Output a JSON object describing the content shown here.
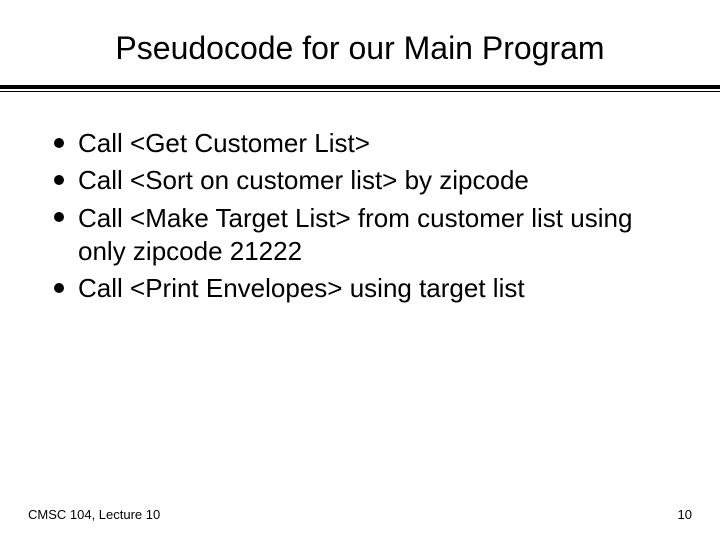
{
  "title": "Pseudocode for our Main Program",
  "bullets": [
    "Call <Get Customer List>",
    "Call <Sort on customer list> by zipcode",
    "Call <Make Target List> from customer list using only zipcode 21222",
    "Call <Print Envelopes> using target list"
  ],
  "footer": {
    "left": "CMSC 104, Lecture 10",
    "right": "10"
  }
}
